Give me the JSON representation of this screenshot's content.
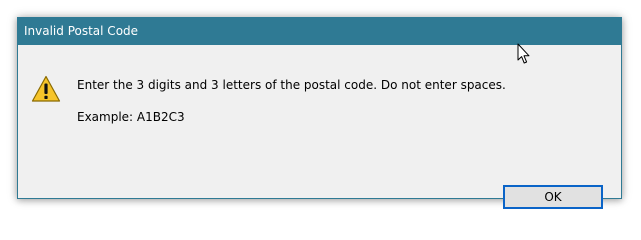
{
  "dialog": {
    "title": "Invalid Postal Code",
    "message": "Enter the 3 digits and 3 letters of the postal code. Do not enter spaces.",
    "example": "Example: A1B2C3",
    "icon": "warning-icon",
    "ok_label": "OK"
  },
  "colors": {
    "titlebar": "#2f7a94",
    "dialog_bg": "#f0f0f0",
    "button_border": "#0a64c8",
    "button_bg": "#e1e1e1",
    "warning_fill": "#f6c42a"
  }
}
